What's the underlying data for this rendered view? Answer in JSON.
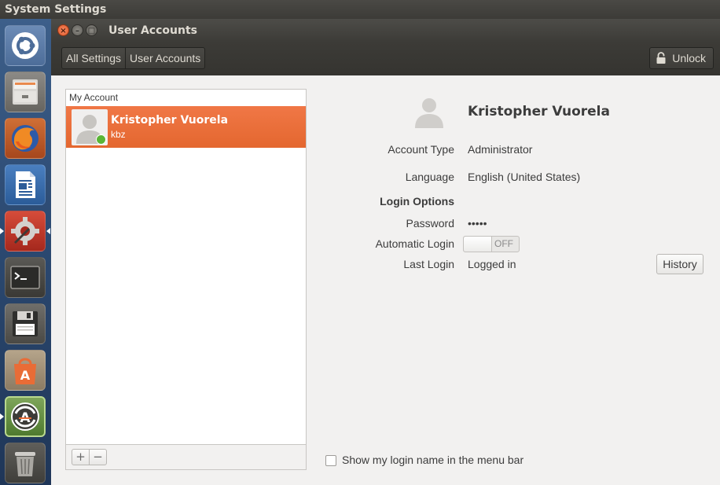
{
  "panel": {
    "app_title": "System Settings"
  },
  "launcher": {
    "items": [
      {
        "icon": "ubuntu-dash-icon"
      },
      {
        "icon": "files-icon"
      },
      {
        "icon": "firefox-icon"
      },
      {
        "icon": "libreoffice-writer-icon"
      },
      {
        "icon": "system-settings-icon",
        "active": true
      },
      {
        "icon": "terminal-icon"
      },
      {
        "icon": "disks-icon"
      },
      {
        "icon": "software-center-icon"
      },
      {
        "icon": "software-updater-icon",
        "running": true
      },
      {
        "icon": "trash-icon"
      }
    ]
  },
  "window": {
    "title": "User Accounts",
    "buttons": {
      "close": "×",
      "minimize": "–",
      "maximize": "□"
    }
  },
  "toolbar": {
    "breadcrumbs": [
      "All Settings",
      "User Accounts"
    ],
    "unlock_label": "Unlock"
  },
  "user_list": {
    "header": "My Account",
    "users": [
      {
        "name": "Kristopher Vuorela",
        "login": "kbz",
        "online": true,
        "selected": true
      }
    ],
    "add_label": "+",
    "remove_label": "−"
  },
  "details": {
    "name": "Kristopher Vuorela",
    "account_type_label": "Account Type",
    "account_type_value": "Administrator",
    "language_label": "Language",
    "language_value": "English (United States)",
    "login_options_heading": "Login Options",
    "password_label": "Password",
    "password_value": "•••••",
    "automatic_login_label": "Automatic Login",
    "automatic_login_state": "OFF",
    "last_login_label": "Last Login",
    "last_login_value": "Logged in",
    "history_label": "History",
    "show_login_name_label": "Show my login name in the menu bar",
    "show_login_name_checked": false
  },
  "colors": {
    "selection": "#e96c36",
    "online": "#5ab536",
    "launcher_bg": "#2c4a72"
  }
}
